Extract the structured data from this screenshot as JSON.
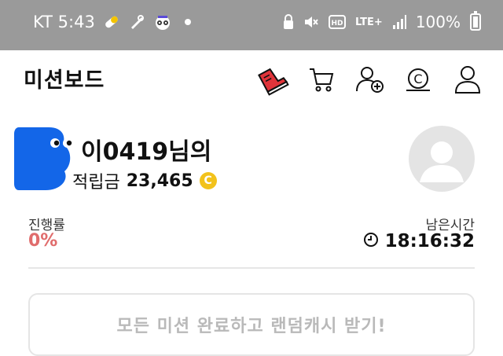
{
  "status_bar": {
    "carrier_time": "KT 5:43",
    "network": "LTE",
    "network_sup": "+",
    "battery": "100%",
    "left_icons": [
      "pill-icon",
      "tool-icon",
      "raccoon-icon"
    ],
    "right_icons": [
      "lock-icon",
      "mute-icon",
      "hd-icon",
      "signal-icon",
      "battery-icon"
    ]
  },
  "header": {
    "title": "미션보드",
    "icons": [
      "sneaker-icon",
      "cart-icon",
      "add-user-icon",
      "cash-coin-icon",
      "profile-icon"
    ],
    "accent": "#e0343a"
  },
  "profile": {
    "nickname": "이0419님의",
    "points_label": "적립금",
    "points_value": "23,465",
    "coin_symbol": "C",
    "coin_color": "#f2c21b",
    "mascot_color": "#1366e8"
  },
  "progress": {
    "label": "진행률",
    "value": "0%",
    "value_color": "#e06c6c"
  },
  "time": {
    "label": "남은시간",
    "value": "18:16:32"
  },
  "mission": {
    "button_label": "모든 미션 완료하고 랜덤캐시 받기!"
  }
}
